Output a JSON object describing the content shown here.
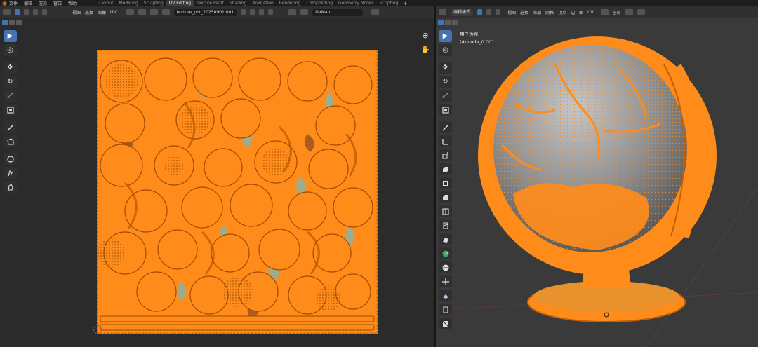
{
  "top_menu": [
    "文件",
    "编辑",
    "渲染",
    "窗口",
    "帮助"
  ],
  "workspace_tabs": [
    {
      "label": "Layout",
      "active": false
    },
    {
      "label": "Modeling",
      "active": false
    },
    {
      "label": "Sculpting",
      "active": false
    },
    {
      "label": "UV Editing",
      "active": true
    },
    {
      "label": "Texture Paint",
      "active": false
    },
    {
      "label": "Shading",
      "active": false
    },
    {
      "label": "Animation",
      "active": false
    },
    {
      "label": "Rendering",
      "active": false
    },
    {
      "label": "Compositing",
      "active": false
    },
    {
      "label": "Geometry Nodes",
      "active": false
    },
    {
      "label": "Scripting",
      "active": false
    }
  ],
  "add_tab": "+",
  "uv_editor": {
    "menu": [
      "视图",
      "选择",
      "图像",
      "UV"
    ],
    "image_name": "texture_pbr_20250901.001",
    "uv_map": "UVMap",
    "selection_color": "#ff8c1a",
    "background_color": "#2b2b2b"
  },
  "viewport": {
    "mode": "编辑模式",
    "menu": [
      "视图",
      "选择",
      "添加",
      "网格",
      "顶点",
      "边",
      "面",
      "UV"
    ],
    "transform": "全局",
    "view_name": "用户透视",
    "object_name": "(4) node_0.001",
    "mesh_color": "#ff8c1a"
  },
  "icons": {
    "select": "▶",
    "cursor": "◎",
    "move": "✥",
    "rotate": "↻",
    "scale": "⤢",
    "zoom": "⊕",
    "pan": "✋"
  }
}
